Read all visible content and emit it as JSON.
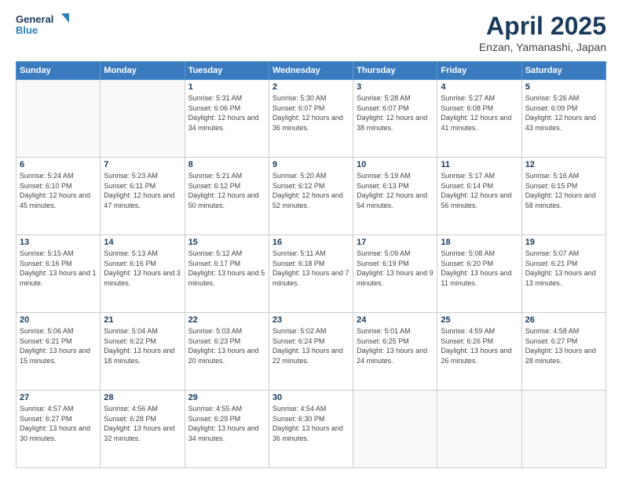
{
  "logo": {
    "line1": "General",
    "line2": "Blue"
  },
  "header": {
    "month_year": "April 2025",
    "location": "Enzan, Yamanashi, Japan"
  },
  "weekdays": [
    "Sunday",
    "Monday",
    "Tuesday",
    "Wednesday",
    "Thursday",
    "Friday",
    "Saturday"
  ],
  "weeks": [
    [
      {
        "day": "",
        "info": ""
      },
      {
        "day": "",
        "info": ""
      },
      {
        "day": "1",
        "info": "Sunrise: 5:31 AM\nSunset: 6:06 PM\nDaylight: 12 hours and 34 minutes."
      },
      {
        "day": "2",
        "info": "Sunrise: 5:30 AM\nSunset: 6:07 PM\nDaylight: 12 hours and 36 minutes."
      },
      {
        "day": "3",
        "info": "Sunrise: 5:28 AM\nSunset: 6:07 PM\nDaylight: 12 hours and 38 minutes."
      },
      {
        "day": "4",
        "info": "Sunrise: 5:27 AM\nSunset: 6:08 PM\nDaylight: 12 hours and 41 minutes."
      },
      {
        "day": "5",
        "info": "Sunrise: 5:26 AM\nSunset: 6:09 PM\nDaylight: 12 hours and 43 minutes."
      }
    ],
    [
      {
        "day": "6",
        "info": "Sunrise: 5:24 AM\nSunset: 6:10 PM\nDaylight: 12 hours and 45 minutes."
      },
      {
        "day": "7",
        "info": "Sunrise: 5:23 AM\nSunset: 6:11 PM\nDaylight: 12 hours and 47 minutes."
      },
      {
        "day": "8",
        "info": "Sunrise: 5:21 AM\nSunset: 6:12 PM\nDaylight: 12 hours and 50 minutes."
      },
      {
        "day": "9",
        "info": "Sunrise: 5:20 AM\nSunset: 6:12 PM\nDaylight: 12 hours and 52 minutes."
      },
      {
        "day": "10",
        "info": "Sunrise: 5:19 AM\nSunset: 6:13 PM\nDaylight: 12 hours and 54 minutes."
      },
      {
        "day": "11",
        "info": "Sunrise: 5:17 AM\nSunset: 6:14 PM\nDaylight: 12 hours and 56 minutes."
      },
      {
        "day": "12",
        "info": "Sunrise: 5:16 AM\nSunset: 6:15 PM\nDaylight: 12 hours and 58 minutes."
      }
    ],
    [
      {
        "day": "13",
        "info": "Sunrise: 5:15 AM\nSunset: 6:16 PM\nDaylight: 13 hours and 1 minute."
      },
      {
        "day": "14",
        "info": "Sunrise: 5:13 AM\nSunset: 6:16 PM\nDaylight: 13 hours and 3 minutes."
      },
      {
        "day": "15",
        "info": "Sunrise: 5:12 AM\nSunset: 6:17 PM\nDaylight: 13 hours and 5 minutes."
      },
      {
        "day": "16",
        "info": "Sunrise: 5:11 AM\nSunset: 6:18 PM\nDaylight: 13 hours and 7 minutes."
      },
      {
        "day": "17",
        "info": "Sunrise: 5:09 AM\nSunset: 6:19 PM\nDaylight: 13 hours and 9 minutes."
      },
      {
        "day": "18",
        "info": "Sunrise: 5:08 AM\nSunset: 6:20 PM\nDaylight: 13 hours and 11 minutes."
      },
      {
        "day": "19",
        "info": "Sunrise: 5:07 AM\nSunset: 6:21 PM\nDaylight: 13 hours and 13 minutes."
      }
    ],
    [
      {
        "day": "20",
        "info": "Sunrise: 5:06 AM\nSunset: 6:21 PM\nDaylight: 13 hours and 15 minutes."
      },
      {
        "day": "21",
        "info": "Sunrise: 5:04 AM\nSunset: 6:22 PM\nDaylight: 13 hours and 18 minutes."
      },
      {
        "day": "22",
        "info": "Sunrise: 5:03 AM\nSunset: 6:23 PM\nDaylight: 13 hours and 20 minutes."
      },
      {
        "day": "23",
        "info": "Sunrise: 5:02 AM\nSunset: 6:24 PM\nDaylight: 13 hours and 22 minutes."
      },
      {
        "day": "24",
        "info": "Sunrise: 5:01 AM\nSunset: 6:25 PM\nDaylight: 13 hours and 24 minutes."
      },
      {
        "day": "25",
        "info": "Sunrise: 4:59 AM\nSunset: 6:26 PM\nDaylight: 13 hours and 26 minutes."
      },
      {
        "day": "26",
        "info": "Sunrise: 4:58 AM\nSunset: 6:27 PM\nDaylight: 13 hours and 28 minutes."
      }
    ],
    [
      {
        "day": "27",
        "info": "Sunrise: 4:57 AM\nSunset: 6:27 PM\nDaylight: 13 hours and 30 minutes."
      },
      {
        "day": "28",
        "info": "Sunrise: 4:56 AM\nSunset: 6:28 PM\nDaylight: 13 hours and 32 minutes."
      },
      {
        "day": "29",
        "info": "Sunrise: 4:55 AM\nSunset: 6:29 PM\nDaylight: 13 hours and 34 minutes."
      },
      {
        "day": "30",
        "info": "Sunrise: 4:54 AM\nSunset: 6:30 PM\nDaylight: 13 hours and 36 minutes."
      },
      {
        "day": "",
        "info": ""
      },
      {
        "day": "",
        "info": ""
      },
      {
        "day": "",
        "info": ""
      }
    ]
  ]
}
